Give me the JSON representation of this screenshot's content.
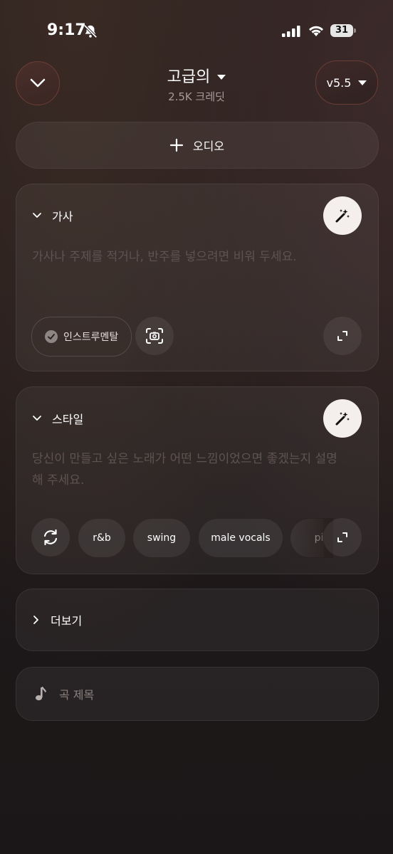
{
  "status_bar": {
    "time": "9:17",
    "battery": "31"
  },
  "header": {
    "title": "고급의",
    "credits": "2.5K 크레딧",
    "version": "v5.5"
  },
  "audio_button": {
    "label": "오디오"
  },
  "lyrics": {
    "heading": "가사",
    "placeholder": "가사나 주제를 적거나, 반주를 넣으려면 비워 두세요.",
    "instrumental_label": "인스트루멘탈"
  },
  "style": {
    "heading": "스타일",
    "placeholder": "당신이 만들고 싶은 노래가 어떤 느낌이었으면 좋겠는지 설명해 주세요.",
    "tags": [
      "r&b",
      "swing",
      "male vocals",
      "pi"
    ]
  },
  "more": {
    "label": "더보기"
  },
  "song_title": {
    "placeholder": "곡 제목"
  }
}
